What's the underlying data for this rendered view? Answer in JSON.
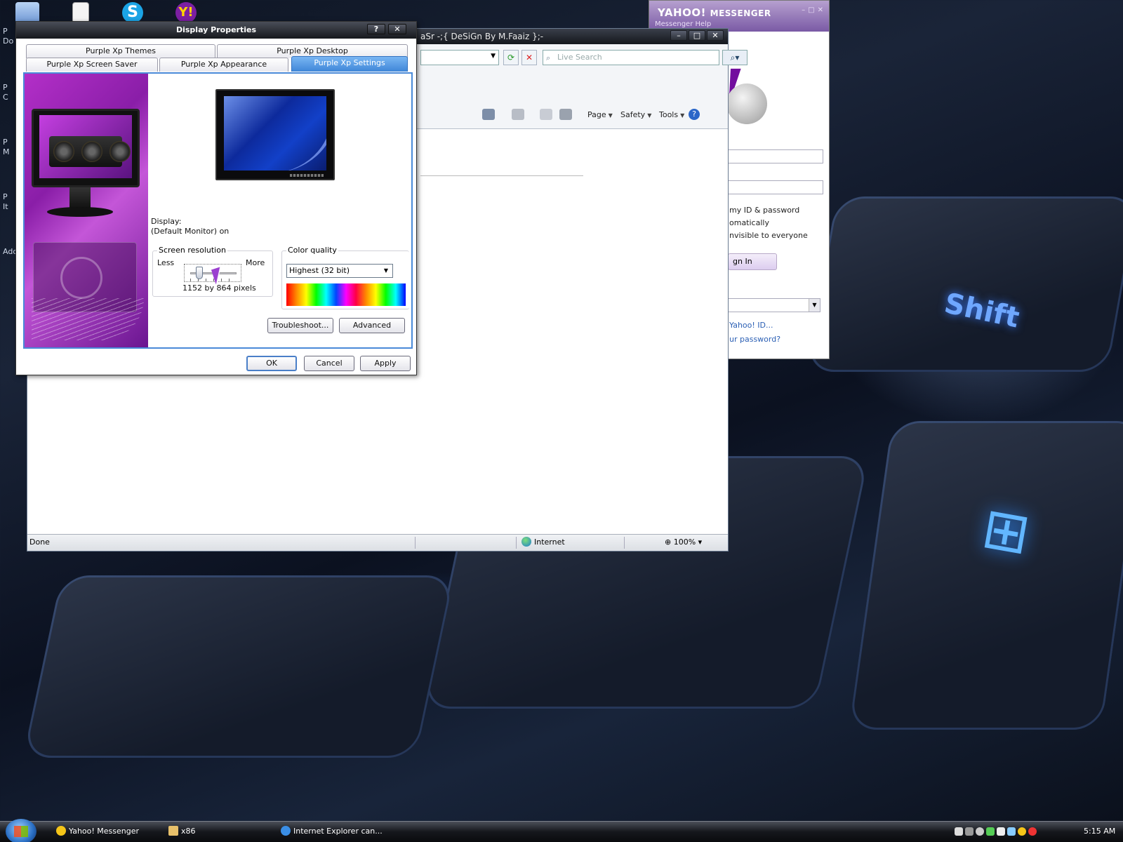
{
  "desktop": {
    "side_labels": [
      "P",
      "Do",
      "P",
      "C",
      "P",
      "M",
      "P",
      "It",
      "Ado"
    ]
  },
  "ie": {
    "title_partial": "aSr -;{ DeSiGn By M.Faaiz };-",
    "search_placeholder": "Live Search",
    "commands": {
      "page": "Page",
      "safety": "Safety",
      "tools": "Tools"
    },
    "status": {
      "text": "Done",
      "zone": "Internet",
      "zoom": "100%"
    }
  },
  "yahoo": {
    "title_main": "YAHOO!",
    "title_sub": "MESSENGER",
    "menu": "Messenger   Help",
    "remember": "my ID & password",
    "auto": "omatically",
    "invisible": "nvisible to everyone",
    "signin": "gn In",
    "get_id": "Yahoo! ID...",
    "forgot": "ur password?"
  },
  "dialog": {
    "title": "Display Properties",
    "help_btn": "?",
    "close_btn": "✕",
    "tabs_row1": [
      "Purple Xp Themes",
      "Purple Xp Desktop"
    ],
    "tabs_row2": [
      "Purple Xp Screen Saver",
      "Purple Xp Appearance",
      "Purple Xp Settings"
    ],
    "display_label": "Display:",
    "display_value": "(Default Monitor) on",
    "resolution": {
      "legend": "Screen resolution",
      "less": "Less",
      "more": "More",
      "value": "1152 by 864 pixels",
      "slider_fraction": 0.2
    },
    "color_quality": {
      "legend": "Color quality",
      "selected": "Highest (32 bit)"
    },
    "troubleshoot_btn": "Troubleshoot...",
    "advanced_btn": "Advanced",
    "ok_btn": "OK",
    "cancel_btn": "Cancel",
    "apply_btn": "Apply"
  },
  "taskbar": {
    "items": [
      "Yahoo! Messenger",
      "x86",
      "Internet Explorer can..."
    ],
    "clock": "5:15 AM"
  }
}
